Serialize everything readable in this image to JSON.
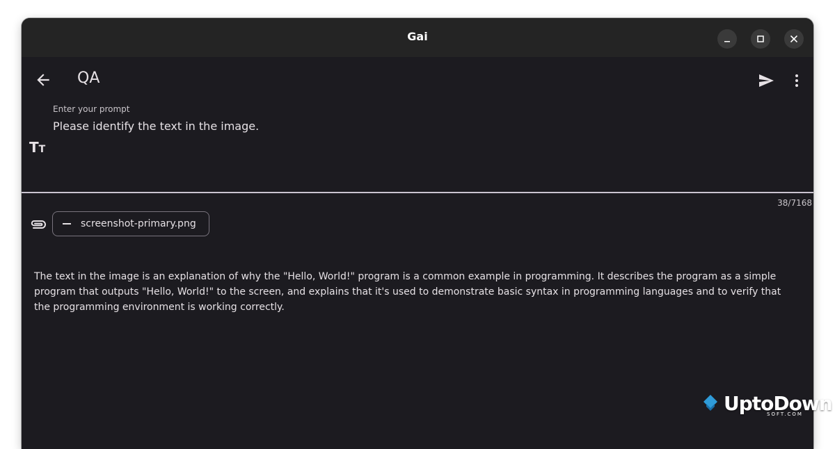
{
  "window": {
    "title": "Gai",
    "controls": [
      "minimize-icon",
      "maximize-icon",
      "close-icon"
    ]
  },
  "appbar": {
    "title": "QA",
    "back_icon": "arrow-left-icon",
    "send_icon": "send-icon",
    "more_icon": "more-vertical-icon"
  },
  "prompt": {
    "label": "Enter your prompt",
    "value": "Please identify the text in the image.",
    "format_icon_glyph_big": "T",
    "format_icon_glyph_small": "T",
    "char_counter": "38/7168"
  },
  "attachment": {
    "icon": "paperclip-icon",
    "file_name": "screenshot-primary.png"
  },
  "response": {
    "text": "The text in the image is an explanation of why the \"Hello, World!\" program is a common example in programming.  It describes the program as a simple program that outputs \"Hello, World!\" to the screen, and explains that it's used to demonstrate basic syntax in programming languages and to verify that the programming environment is working correctly."
  },
  "watermark": {
    "brand": "UptoDown",
    "sub": "SOFT.COM",
    "accent": "#2f9bd8"
  },
  "colors": {
    "background": "#1c1b20",
    "titlebar": "#242424",
    "text": "#e6e1e5",
    "divider": "#cac4d0",
    "outline": "#79747e"
  }
}
